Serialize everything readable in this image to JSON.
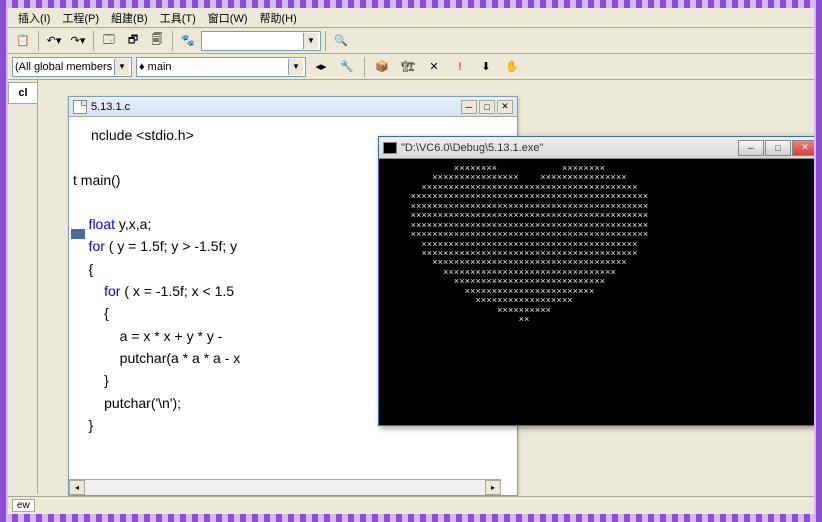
{
  "menu": {
    "items": [
      "插入(I)",
      "工程(P)",
      "組建(B)",
      "工具(T)",
      "窗口(W)",
      "帮助(H)"
    ]
  },
  "toolbar1": {
    "combo_empty": ""
  },
  "toolbar2": {
    "scope_combo": "(All global members",
    "member_combo": "main"
  },
  "sidebar": {
    "tab": "cl"
  },
  "code_window": {
    "title": "5.13.1.c",
    "lines": {
      "l1a": "nclude ",
      "l1b": "<stdio.h>",
      "l2": "",
      "l3": "t main()",
      "l4": "",
      "l5a": "    float",
      "l5b": " y,x,a;",
      "l6a": "    for",
      "l6b": " ( y = 1.5f; y > -1.5f; y",
      "l7": "    {",
      "l8a": "        for",
      "l8b": " ( x = -1.5f; x < 1.5",
      "l9": "        {",
      "l10": "            a = x * x + y * y -",
      "l11": "            putchar(a * a * a - x",
      "l12": "        }",
      "l13a": "        putchar(",
      "l13b": "'\\n'",
      "l13c": ");",
      "l14": "    }"
    }
  },
  "console_window": {
    "title": "\"D:\\VC6.0\\Debug\\5.13.1.exe\"",
    "heart": "            ××××××××            ××××××××\n        ××××××××××××××××    ××××××××××××××××\n      ××××××××××××××××××××××××××××××××××××××××\n    ××××××××××××××××××××××××××××××××××××××××××××\n    ××××××××××××××××××××××××××××××××××××××××××××\n    ××××××××××××××××××××××××××××××××××××××××××××\n    ××××××××××××××××××××××××××××××××××××××××××××\n    ××××××××××××××××××××××××××××××××××××××××××××\n      ××××××××××××××××××××××××××××××××××××××××\n      ××××××××××××××××××××××××××××××××××××××××\n        ××××××××××××××××××××××××××××××××××××\n          ××××××××××××××××××××××××××××××××\n            ××××××××××××××××××××××××××××\n              ××××××××××××××××××××××××\n                ××××××××××××××××××\n                    ××××××××××\n                        ××"
  },
  "statusbar": {
    "tab": "ew"
  }
}
